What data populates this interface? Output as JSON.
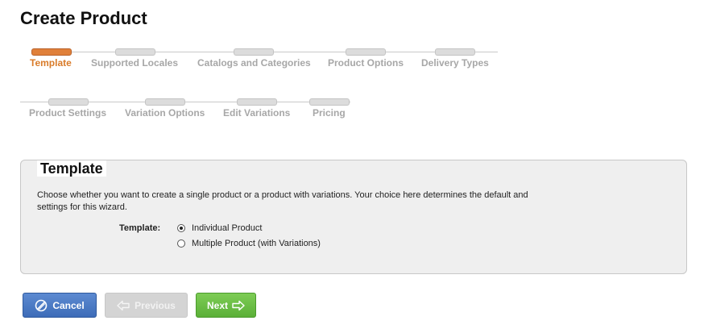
{
  "page_title": "Create Product",
  "steps": [
    {
      "label": "Template",
      "active": true
    },
    {
      "label": "Supported Locales",
      "active": false
    },
    {
      "label": "Catalogs and Categories",
      "active": false
    },
    {
      "label": "Product Options",
      "active": false
    },
    {
      "label": "Delivery Types",
      "active": false
    },
    {
      "label": "Product Settings",
      "active": false
    },
    {
      "label": "Variation Options",
      "active": false
    },
    {
      "label": "Edit Variations",
      "active": false
    },
    {
      "label": "Pricing",
      "active": false
    }
  ],
  "template_box": {
    "title": "Template",
    "description": "Choose whether you want to create a single product or a product with variations. Your choice here determines the default and settings for this wizard.",
    "field_label": "Template:",
    "options": [
      {
        "label": "Individual Product",
        "selected": true
      },
      {
        "label": "Multiple Product (with Variations)",
        "selected": false
      }
    ]
  },
  "buttons": {
    "cancel": "Cancel",
    "previous": "Previous",
    "next": "Next"
  },
  "colors": {
    "active_step": "#d97b29",
    "cancel_button": "#4a78c4",
    "next_button": "#6cbf47",
    "disabled_button": "#d4d4d4"
  }
}
